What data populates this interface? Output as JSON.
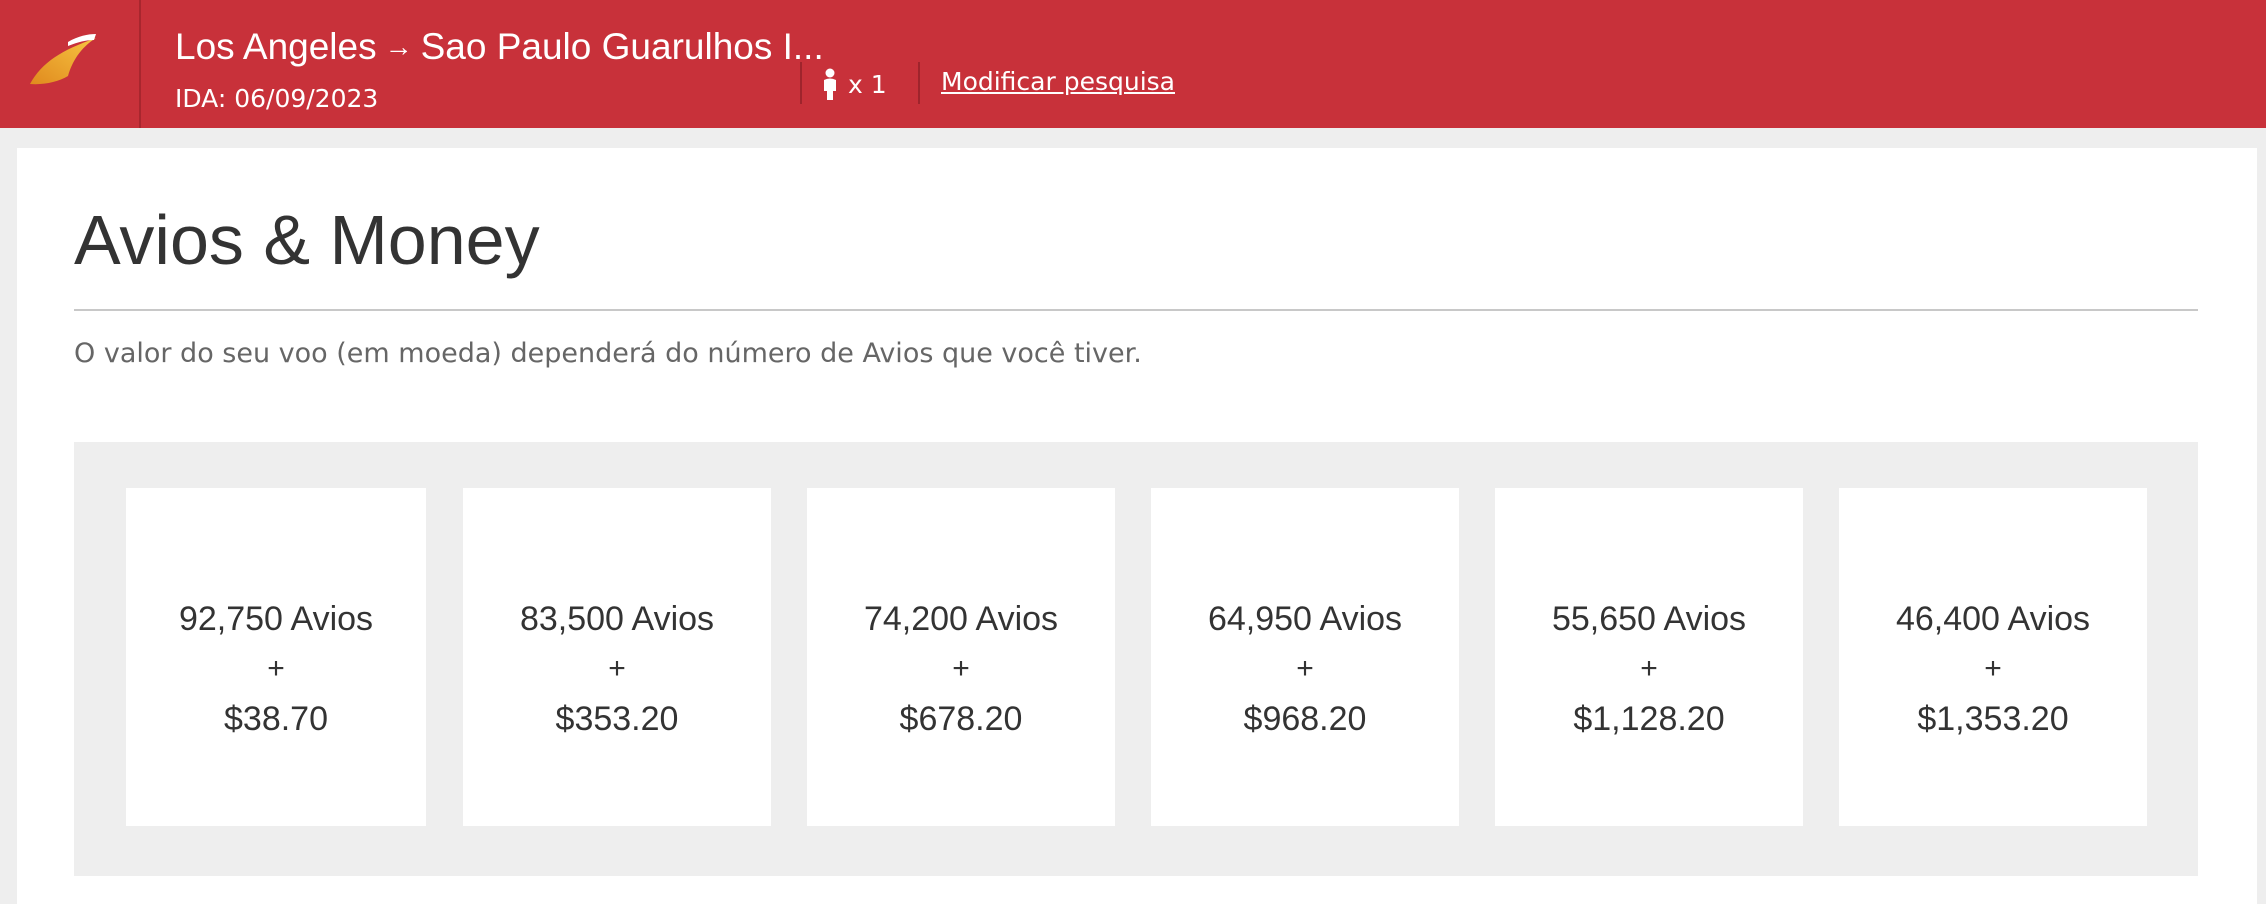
{
  "header": {
    "origin": "Los Angeles",
    "arrow_icon": "→",
    "destination": "Sao Paulo Guarulhos I...",
    "date_label": "IDA: 06/09/2023",
    "passengers": "x 1",
    "modify_label": "Modificar pesquisa",
    "brand_color": "#c8313a"
  },
  "page": {
    "title": "Avios & Money",
    "subtitle": "O valor do seu voo (em moeda) dependerá do número de Avios que você tiver."
  },
  "options": [
    {
      "avios": "92,750 Avios",
      "plus": "+",
      "money": "$38.70"
    },
    {
      "avios": "83,500 Avios",
      "plus": "+",
      "money": "$353.20"
    },
    {
      "avios": "74,200 Avios",
      "plus": "+",
      "money": "$678.20"
    },
    {
      "avios": "64,950 Avios",
      "plus": "+",
      "money": "$968.20"
    },
    {
      "avios": "55,650 Avios",
      "plus": "+",
      "money": "$1,128.20"
    },
    {
      "avios": "46,400 Avios",
      "plus": "+",
      "money": "$1,353.20"
    }
  ]
}
